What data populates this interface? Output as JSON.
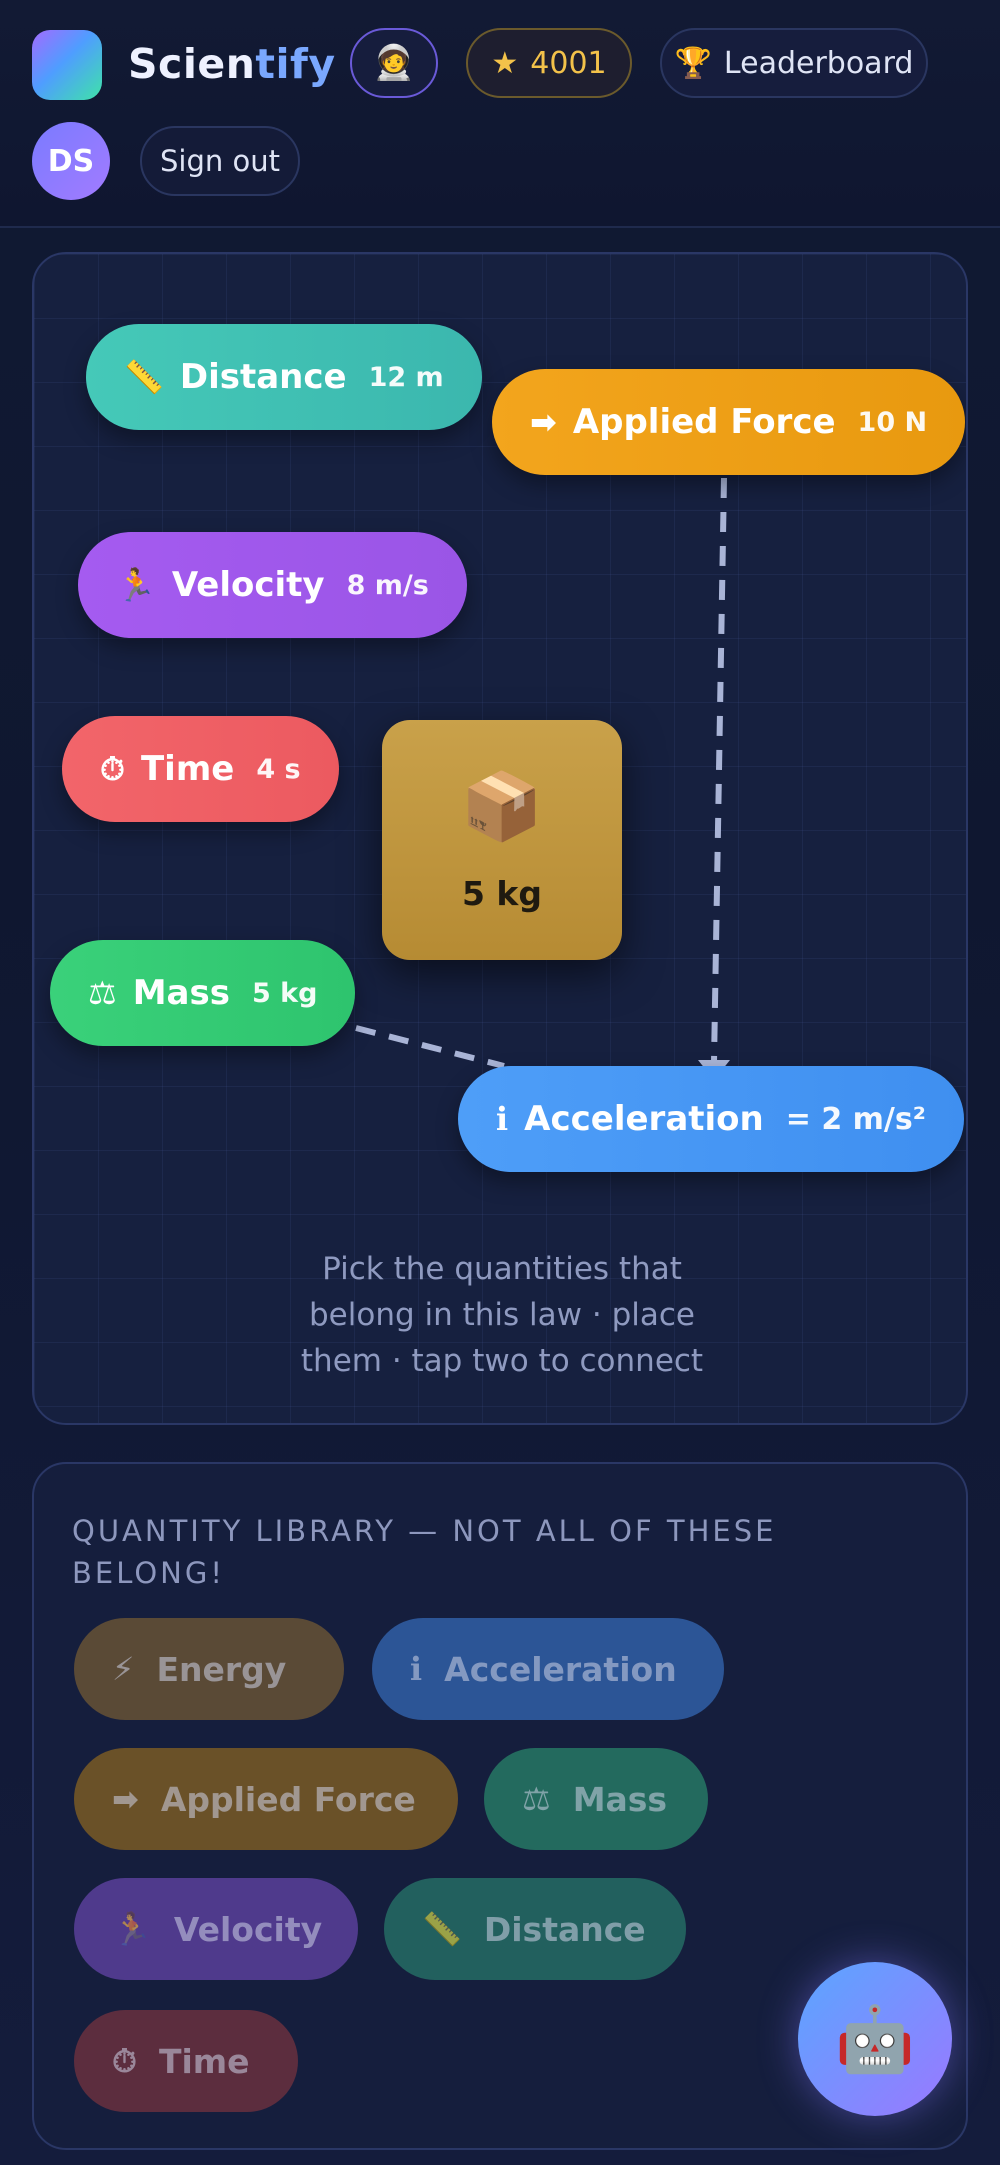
{
  "header": {
    "brand_part1": "Scien",
    "brand_part2": "tify",
    "avatar_emoji": "🧑‍🚀",
    "score_icon": "★",
    "score": "4001",
    "leaderboard_icon": "🏆",
    "leaderboard_label": "Leaderboard",
    "user_initials": "DS",
    "signout_label": "Sign out"
  },
  "canvas": {
    "nodes": {
      "distance": {
        "icon": "📏",
        "label": "Distance",
        "value": "12 m"
      },
      "force": {
        "icon": "➡",
        "label": "Applied Force",
        "value": "10 N"
      },
      "velocity": {
        "icon": "🏃",
        "label": "Velocity",
        "value": "8 m/s"
      },
      "time": {
        "icon": "⏱",
        "label": "Time",
        "value": "4 s"
      },
      "mass": {
        "icon": "⚖",
        "label": "Mass",
        "value": "5 kg"
      },
      "acceleration": {
        "icon": "ℹ",
        "label": "Acceleration",
        "value": "= 2 m/s²"
      }
    },
    "object": {
      "icon": "📦",
      "mass": "5 kg"
    },
    "hint": "Pick the quantities that belong in this law · place them · tap two to connect"
  },
  "library": {
    "title": "QUANTITY LIBRARY — NOT ALL OF THESE BELONG!",
    "chips": {
      "energy": {
        "icon": "⚡",
        "label": "Energy"
      },
      "acceleration": {
        "icon": "ℹ",
        "label": "Acceleration"
      },
      "force": {
        "icon": "➡",
        "label": "Applied Force"
      },
      "mass": {
        "icon": "⚖",
        "label": "Mass"
      },
      "velocity": {
        "icon": "🏃",
        "label": "Velocity"
      },
      "distance": {
        "icon": "📏",
        "label": "Distance"
      },
      "time": {
        "icon": "⏱",
        "label": "Time"
      }
    }
  },
  "assistant": {
    "icon": "🤖"
  },
  "colors": {
    "distance": "#45c9b8",
    "force": "#f3a51d",
    "velocity": "#a55bf0",
    "time": "#f2656a",
    "mass": "#3ad17a",
    "acceleration": "#4e9ef8",
    "score": "#f3c24a"
  }
}
